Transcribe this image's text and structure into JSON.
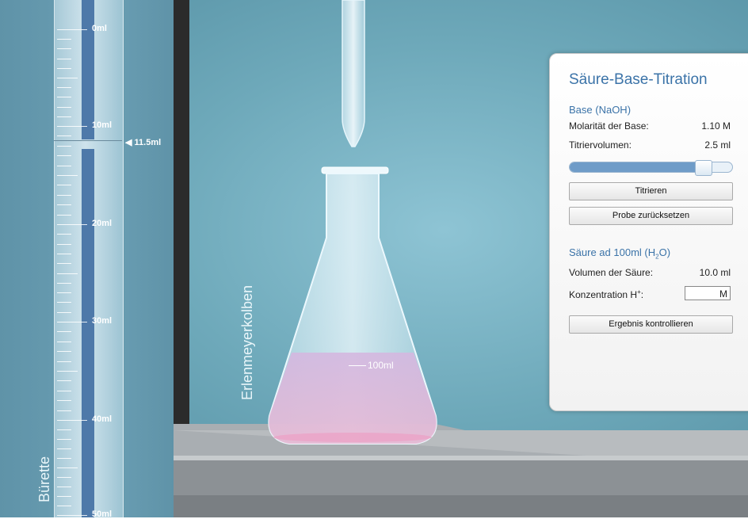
{
  "burette": {
    "caption": "Bürette",
    "level_marker": "◀ 11.5ml",
    "ticks": [
      "0ml",
      "10ml",
      "20ml",
      "30ml",
      "40ml",
      "50ml"
    ]
  },
  "flask": {
    "caption": "Erlenmeyerkolben",
    "volume_mark": "100ml"
  },
  "panel": {
    "title": "Säure-Base-Titration",
    "base_section": "Base (NaOH)",
    "molarity_label": "Molarität der Base:",
    "molarity_value": "1.10 M",
    "titer_label": "Titriervolumen:",
    "titer_value": "2.5 ml",
    "slider_fraction": 0.82,
    "titrate_button": "Titrieren",
    "reset_button": "Probe zurücksetzen",
    "acid_section_prefix": "Säure ad 100ml (H",
    "acid_section_sub": "2",
    "acid_section_suffix": "O)",
    "acid_volume_label": "Volumen der Säure:",
    "acid_volume_value": "10.0 ml",
    "conc_label_prefix": "Konzentration H",
    "conc_label_sup": "+",
    "conc_label_suffix": ":",
    "conc_input_value": "",
    "conc_unit": "M",
    "check_button": "Ergebnis kontrollieren"
  },
  "colors": {
    "accent": "#3b73a8",
    "burette_liquid": "#4e79a9",
    "flask_liquid": "#d8b4df"
  }
}
